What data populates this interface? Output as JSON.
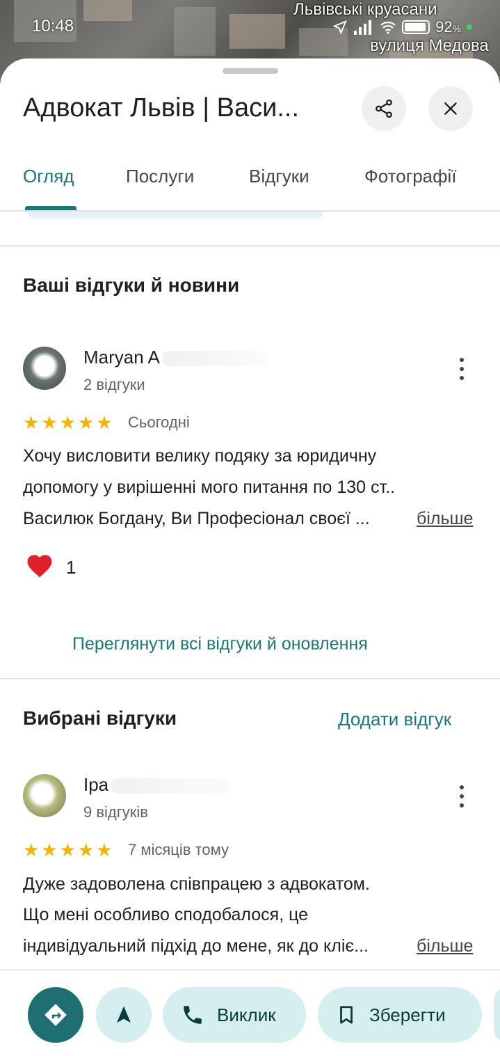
{
  "status_bar": {
    "time": "10:48",
    "battery": "92",
    "battery_unit": "%"
  },
  "map": {
    "labels": [
      "Львівські круасани",
      "вулиця Медова"
    ]
  },
  "place": {
    "title": "Адвокат Львів | Васи..."
  },
  "tabs": [
    {
      "label": "Огляд",
      "active": true
    },
    {
      "label": "Послуги",
      "active": false
    },
    {
      "label": "Відгуки",
      "active": false
    },
    {
      "label": "Фотографії",
      "active": false
    }
  ],
  "your_reviews": {
    "title": "Ваші відгуки й новини",
    "review": {
      "name": "Maryan A",
      "meta": "2 відгуки",
      "rating": 5,
      "date": "Сьогодні",
      "lines": [
        "Хочу висловити велику подяку за юридичну",
        "допомогу у вирішенні мого питання по 130 ст..",
        "Василюк Богдану, Ви Професіонал своєї ..."
      ],
      "more": "більше",
      "likes": "1"
    },
    "view_all": "Переглянути всі відгуки й оновлення"
  },
  "featured_reviews": {
    "title": "Вибрані відгуки",
    "add_review": "Додати відгук",
    "review": {
      "name": "Іра",
      "meta": "9 відгуків",
      "rating": 5,
      "date": "7 місяців тому",
      "lines": [
        "Дуже задоволена співпрацею з адвокатом.",
        "Що мені особливо сподобалося, це",
        "індивідуальний підхід до мене, як до кліє..."
      ],
      "more": "більше"
    }
  },
  "actions": {
    "call": "Виклик",
    "save": "Зберегти"
  },
  "colors": {
    "accent": "#1a7775",
    "star": "#f4b400",
    "pill_bg": "#d5eff0",
    "directions_bg": "#1f6e72"
  }
}
